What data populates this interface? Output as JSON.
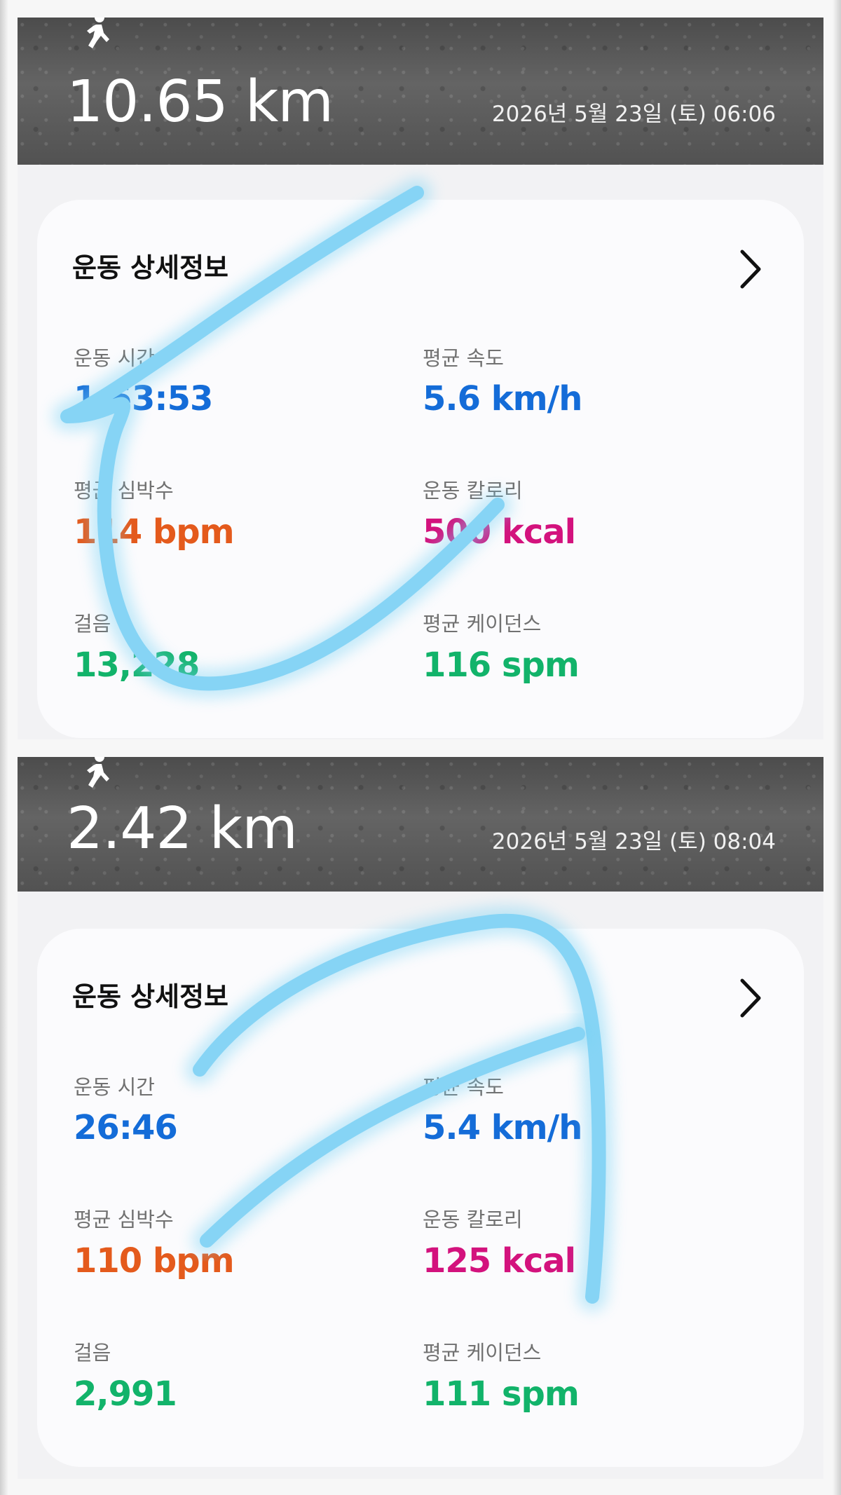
{
  "colors": {
    "time": "#146cd8",
    "speed": "#146cd8",
    "heart_rate": "#e45a1c",
    "calories": "#d3127d",
    "steps": "#12b36a",
    "cadence": "#12b36a",
    "scribble": "#86d4f5"
  },
  "icons": {
    "header_icon": "running-person-icon",
    "card_link_icon": "chevron-right-icon"
  },
  "workouts": [
    {
      "distance": "10.65 km",
      "datetime": "2026년 5월 23일 (토) 06:06",
      "card_title": "운동 상세정보",
      "metrics": {
        "time": {
          "label": "운동 시간",
          "value": "1:53:53"
        },
        "avg_speed": {
          "label": "평균 속도",
          "value": "5.6 km/h"
        },
        "avg_heart_rate": {
          "label": "평균 심박수",
          "value": "114 bpm"
        },
        "calories": {
          "label": "운동 칼로리",
          "value": "500 kcal"
        },
        "steps": {
          "label": "걸음",
          "value": "13,228"
        },
        "avg_cadence": {
          "label": "평균 케이던스",
          "value": "116 spm"
        }
      }
    },
    {
      "distance": "2.42 km",
      "datetime": "2026년 5월 23일 (토) 08:04",
      "card_title": "운동 상세정보",
      "metrics": {
        "time": {
          "label": "운동 시간",
          "value": "26:46"
        },
        "avg_speed": {
          "label": "평균 속도",
          "value": "5.4 km/h"
        },
        "avg_heart_rate": {
          "label": "평균 심박수",
          "value": "110 bpm"
        },
        "calories": {
          "label": "운동 칼로리",
          "value": "125 kcal"
        },
        "steps": {
          "label": "걸음",
          "value": "2,991"
        },
        "avg_cadence": {
          "label": "평균 케이던스",
          "value": "111 spm"
        }
      }
    }
  ]
}
